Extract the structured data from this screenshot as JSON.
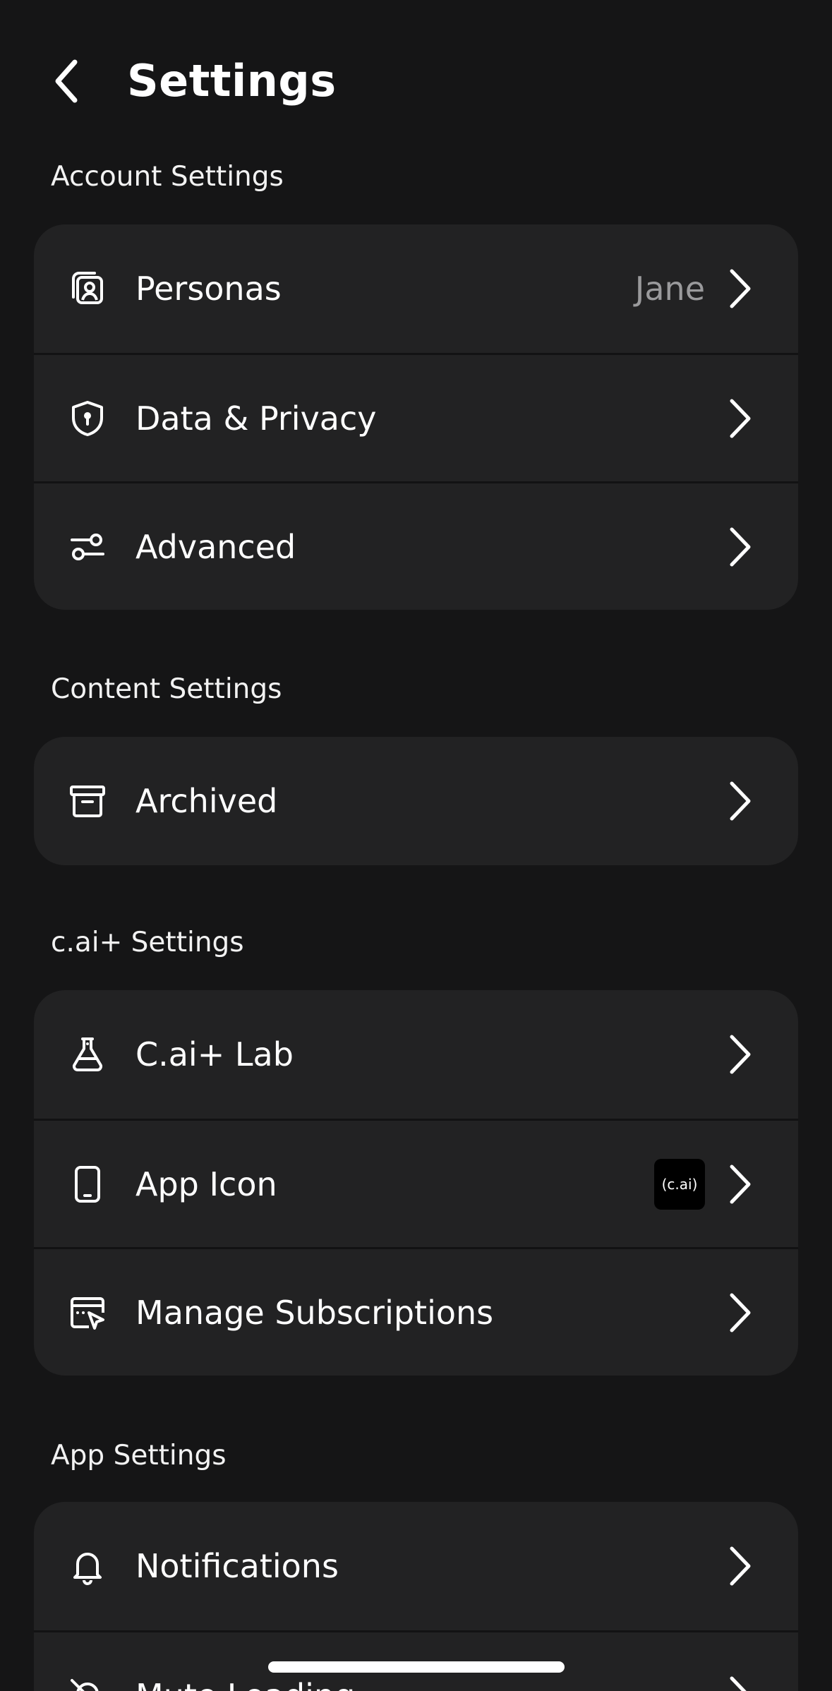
{
  "header": {
    "title": "Settings"
  },
  "sections": [
    {
      "title": "Account Settings",
      "items": [
        {
          "label": "Personas",
          "value": "Jane",
          "icon": "personas-icon"
        },
        {
          "label": "Data & Privacy",
          "icon": "shield-icon"
        },
        {
          "label": "Advanced",
          "icon": "sliders-icon"
        }
      ]
    },
    {
      "title": "Content Settings",
      "items": [
        {
          "label": "Archived",
          "icon": "archive-icon"
        }
      ]
    },
    {
      "title": "c.ai+ Settings",
      "items": [
        {
          "label": "C.ai+ Lab",
          "icon": "flask-icon"
        },
        {
          "label": "App Icon",
          "badge": "(c.ai)",
          "icon": "phone-icon"
        },
        {
          "label": "Manage Subscriptions",
          "icon": "subscription-icon"
        }
      ]
    },
    {
      "title": "App Settings",
      "items": [
        {
          "label": "Notifications",
          "icon": "bell-icon"
        },
        {
          "label": "Mute Loading",
          "icon": "mute-icon"
        }
      ]
    }
  ],
  "colors": {
    "background": "#151516",
    "card": "#222223",
    "secondary_text": "#9a9a9c"
  }
}
